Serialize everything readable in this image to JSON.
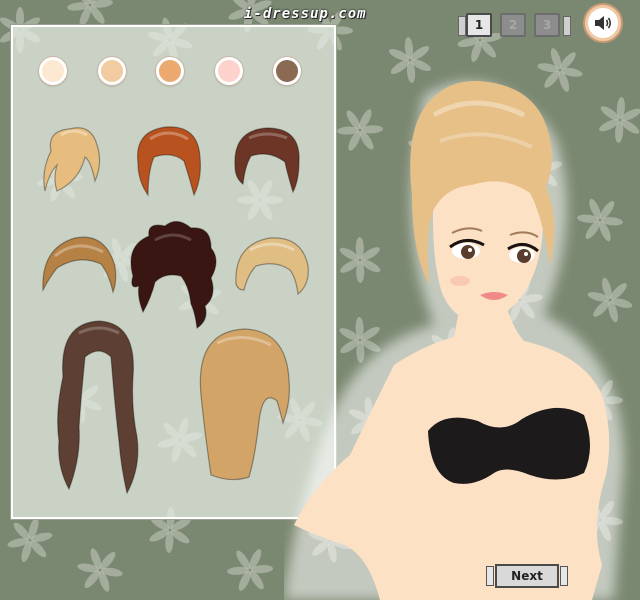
{
  "site": {
    "logo_text": "i-dressup.com"
  },
  "pagination": {
    "pages": [
      "1",
      "2",
      "3"
    ],
    "active_page": "1"
  },
  "sound": {
    "icon": "speaker-icon"
  },
  "skin_tones": [
    "#fde8d1",
    "#f3cba3",
    "#eba970",
    "#fdd2cd",
    "#8b6a53"
  ],
  "hair_options": [
    {
      "id": "blonde-updo",
      "color": "#e7bd7f"
    },
    {
      "id": "auburn-bob",
      "color": "#b8521f"
    },
    {
      "id": "dark-brown-bob",
      "color": "#6c3525"
    },
    {
      "id": "golden-side-swept",
      "color": "#b68145"
    },
    {
      "id": "messy-dark-bun",
      "color": "#3a1613"
    },
    {
      "id": "light-blonde-wave",
      "color": "#e0bd83"
    },
    {
      "id": "long-brown-waves",
      "color": "#5d4033"
    },
    {
      "id": "long-straight-blonde",
      "color": "#d2a468"
    }
  ],
  "model": {
    "skin": "#fde1c4",
    "hair": "#e7c088",
    "top_color": "#1c1a1a",
    "lip": "#f08a8a"
  },
  "actions": {
    "next_label": "Next"
  }
}
